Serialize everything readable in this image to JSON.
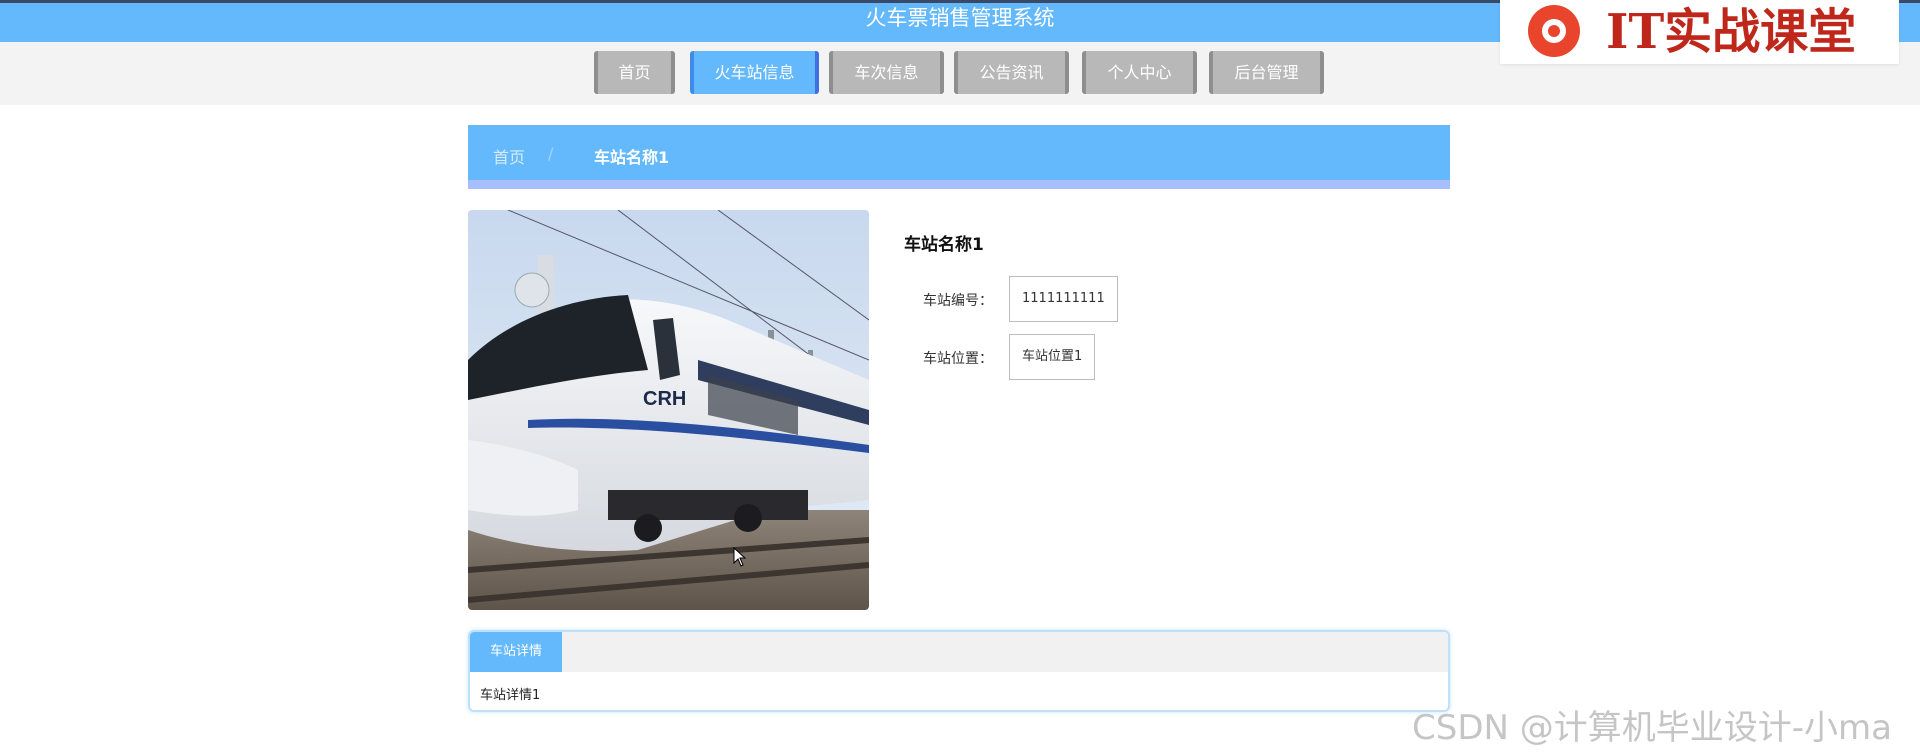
{
  "header": {
    "title": "火车票销售管理系统"
  },
  "logo": {
    "text": "IT实战课堂",
    "icon": "chrome-like-logo-icon",
    "color": "#c0271b"
  },
  "nav": {
    "items": [
      {
        "label": "首页",
        "active": false
      },
      {
        "label": "火车站信息",
        "active": true
      },
      {
        "label": "车次信息",
        "active": false
      },
      {
        "label": "公告资讯",
        "active": false
      },
      {
        "label": "个人中心",
        "active": false
      },
      {
        "label": "后台管理",
        "active": false
      }
    ]
  },
  "breadcrumb": {
    "home": "首页",
    "separator": "/",
    "current": "车站名称1"
  },
  "station": {
    "name": "车站名称1",
    "image": "train-photo",
    "fields": [
      {
        "label": "车站编号：",
        "value": "1111111111"
      },
      {
        "label": "车站位置：",
        "value": "车站位置1"
      }
    ]
  },
  "details": {
    "tab_label": "车站详情",
    "content": "车站详情1"
  },
  "watermark": {
    "text": "CSDN @计算机毕业设计-小ma"
  },
  "colors": {
    "primary": "#64b9fc",
    "nav_inactive": "#b8b8b8",
    "breadcrumb_border": "#a8bfff"
  }
}
